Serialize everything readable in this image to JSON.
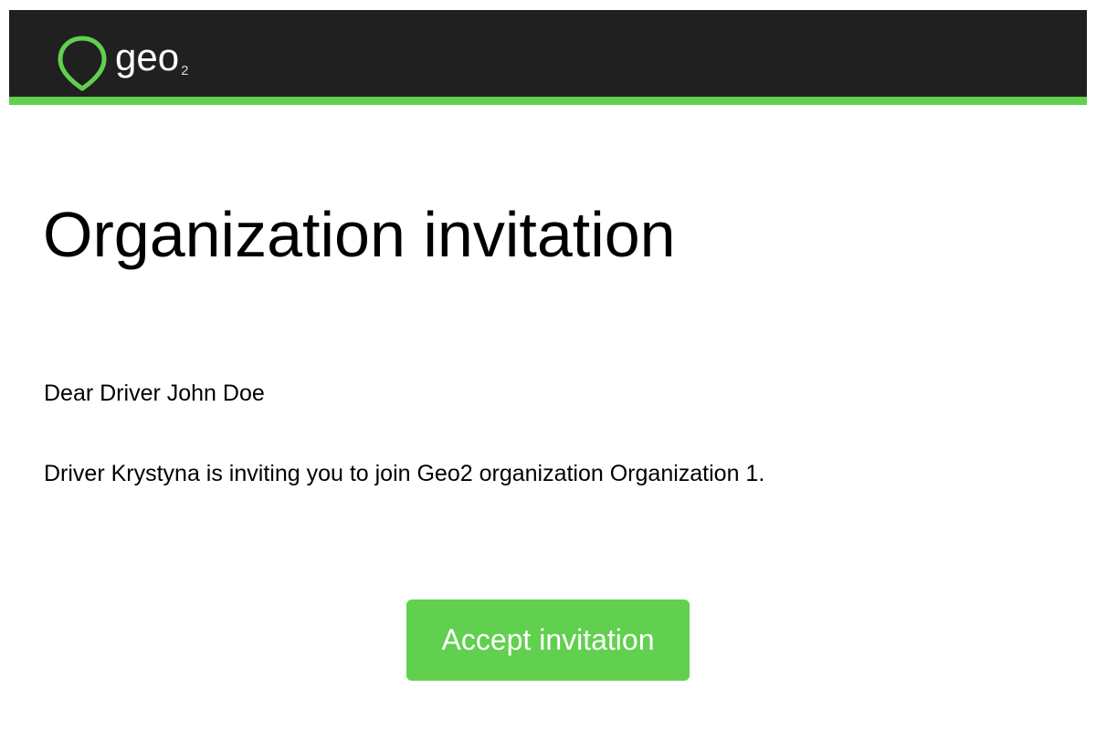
{
  "header": {
    "logo": {
      "icon": "map-pin-icon",
      "wordmark": "geo",
      "wordmark_sub": "2"
    }
  },
  "colors": {
    "header_bg": "#202020",
    "accent": "#61d04f",
    "button_text": "#ffffff"
  },
  "email": {
    "title": "Organization invitation",
    "greeting": "Dear Driver John Doe",
    "message": "Driver Krystyna is inviting you to join Geo2 organization Organization 1.",
    "accept_label": "Accept invitation"
  }
}
